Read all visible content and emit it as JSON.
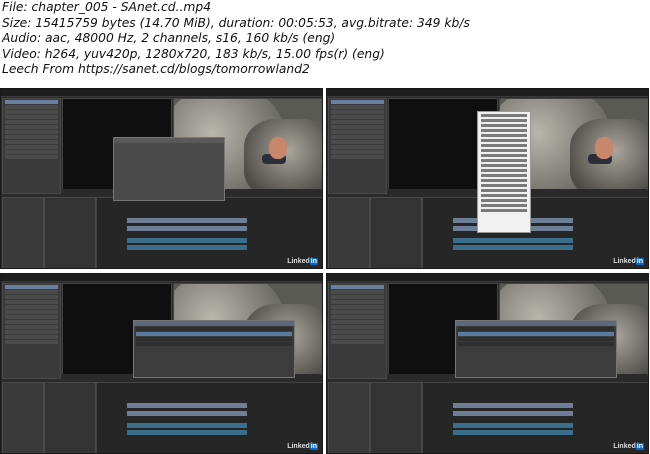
{
  "info": {
    "file": "File: chapter_005 - SAnet.cd..mp4",
    "size": "Size: 15415759 bytes (14.70 MiB), duration: 00:05:53, avg.bitrate: 349 kb/s",
    "audio": "Audio: aac, 48000 Hz, 2 channels, s16, 160 kb/s (eng)",
    "video": "Video: h264, yuv420p, 1280x720, 183 kb/s, 15.00 fps(r) (eng)",
    "leech": "Leech From https://sanet.cd/blogs/tomorrowland2"
  },
  "thumbnails": [
    {
      "watermark": "Linked",
      "watermark_badge": "in",
      "overlay": "dialog"
    },
    {
      "watermark": "Linked",
      "watermark_badge": "in",
      "overlay": "context-menu"
    },
    {
      "watermark": "Linked",
      "watermark_badge": "in",
      "overlay": "table-dialog"
    },
    {
      "watermark": "Linked",
      "watermark_badge": "in",
      "overlay": "table-dialog"
    }
  ],
  "colors": {
    "background": "#ffffff",
    "app_bg": "#2b2b2b",
    "clip_blue": "#6e7e96",
    "selection": "#5a7aa0",
    "linkedin_blue": "#0a66c2"
  }
}
